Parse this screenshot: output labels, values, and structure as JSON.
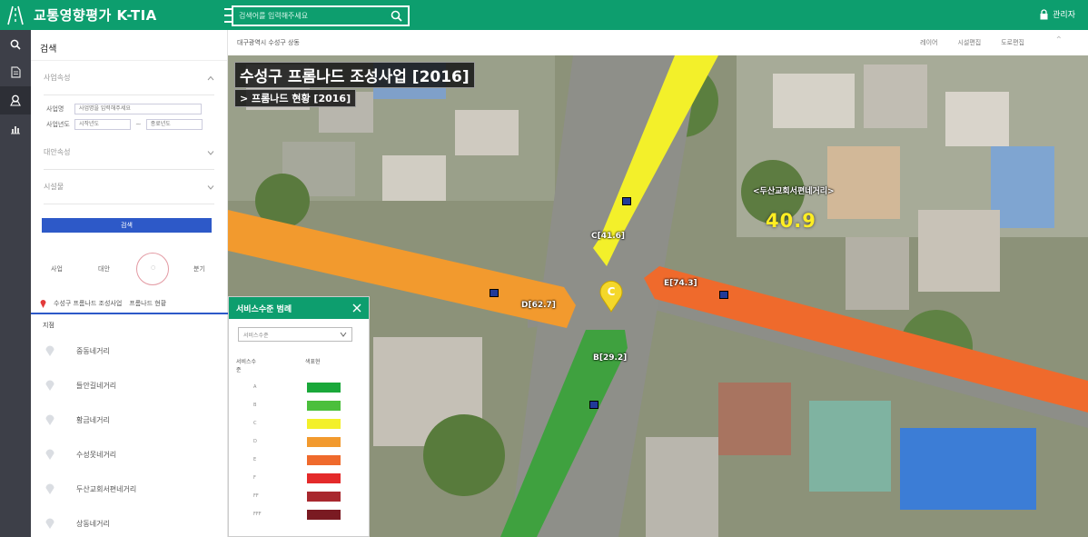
{
  "app": {
    "title": "교통영향평가 K-TIA",
    "admin_label": "관리자"
  },
  "search": {
    "placeholder": "검색어를 입력해주세요"
  },
  "rail": {
    "items": [
      {
        "name": "search-icon"
      },
      {
        "name": "document-icon"
      },
      {
        "name": "map-pin-icon"
      },
      {
        "name": "bar-chart-icon"
      }
    ]
  },
  "panel": {
    "title": "검색",
    "sections": {
      "project": "사업속성",
      "target": "대안속성",
      "facility": "시설물"
    },
    "fields": {
      "project_name_label": "사업명",
      "project_name_placeholder": "사업명을 입력해주세요",
      "year_label": "사업년도",
      "year_start_placeholder": "시작년도",
      "year_end_placeholder": "종료년도"
    },
    "search_button": "검색",
    "ring_labels": {
      "left": "사업",
      "middle": "대안",
      "ring": "○",
      "right": "분기"
    },
    "crumb": {
      "project": "수성구 프롬나드 조성사업",
      "status": "프롬나드 현황"
    },
    "list_title": "지점",
    "intersections": [
      "중동네거리",
      "들안길네거리",
      "황금네거리",
      "수성못네거리",
      "두산교회서편네거리",
      "상동네거리"
    ]
  },
  "map": {
    "address": "대구광역시 수성구 상동",
    "tools": [
      "레이어",
      "시설편집",
      "도로편집"
    ],
    "title": "수성구 프롬나드 조성사업 [2016]",
    "subtitle": "> 프롬나드 현황 [2016]",
    "place_name": "<두산교회서편네거리>",
    "big_value": "40.9",
    "marker_letter": "C",
    "roads": {
      "north": "C[41.6]",
      "east": "E[74.3]",
      "west": "D[62.7]",
      "south": "B[29.2]"
    }
  },
  "legend": {
    "title": "서비스수준 범례",
    "select_value": "서비스수준",
    "col_grade": "서비스수준",
    "col_color": "색표현",
    "grades": [
      {
        "grade": "A",
        "color": "#1aa83a"
      },
      {
        "grade": "B",
        "color": "#4bbf3c"
      },
      {
        "grade": "C",
        "color": "#f3f02a"
      },
      {
        "grade": "D",
        "color": "#f29a2e"
      },
      {
        "grade": "E",
        "color": "#ef6a2c"
      },
      {
        "grade": "F",
        "color": "#e42a2a"
      },
      {
        "grade": "FF",
        "color": "#a8282e"
      },
      {
        "grade": "FFF",
        "color": "#7a1a22"
      }
    ]
  }
}
